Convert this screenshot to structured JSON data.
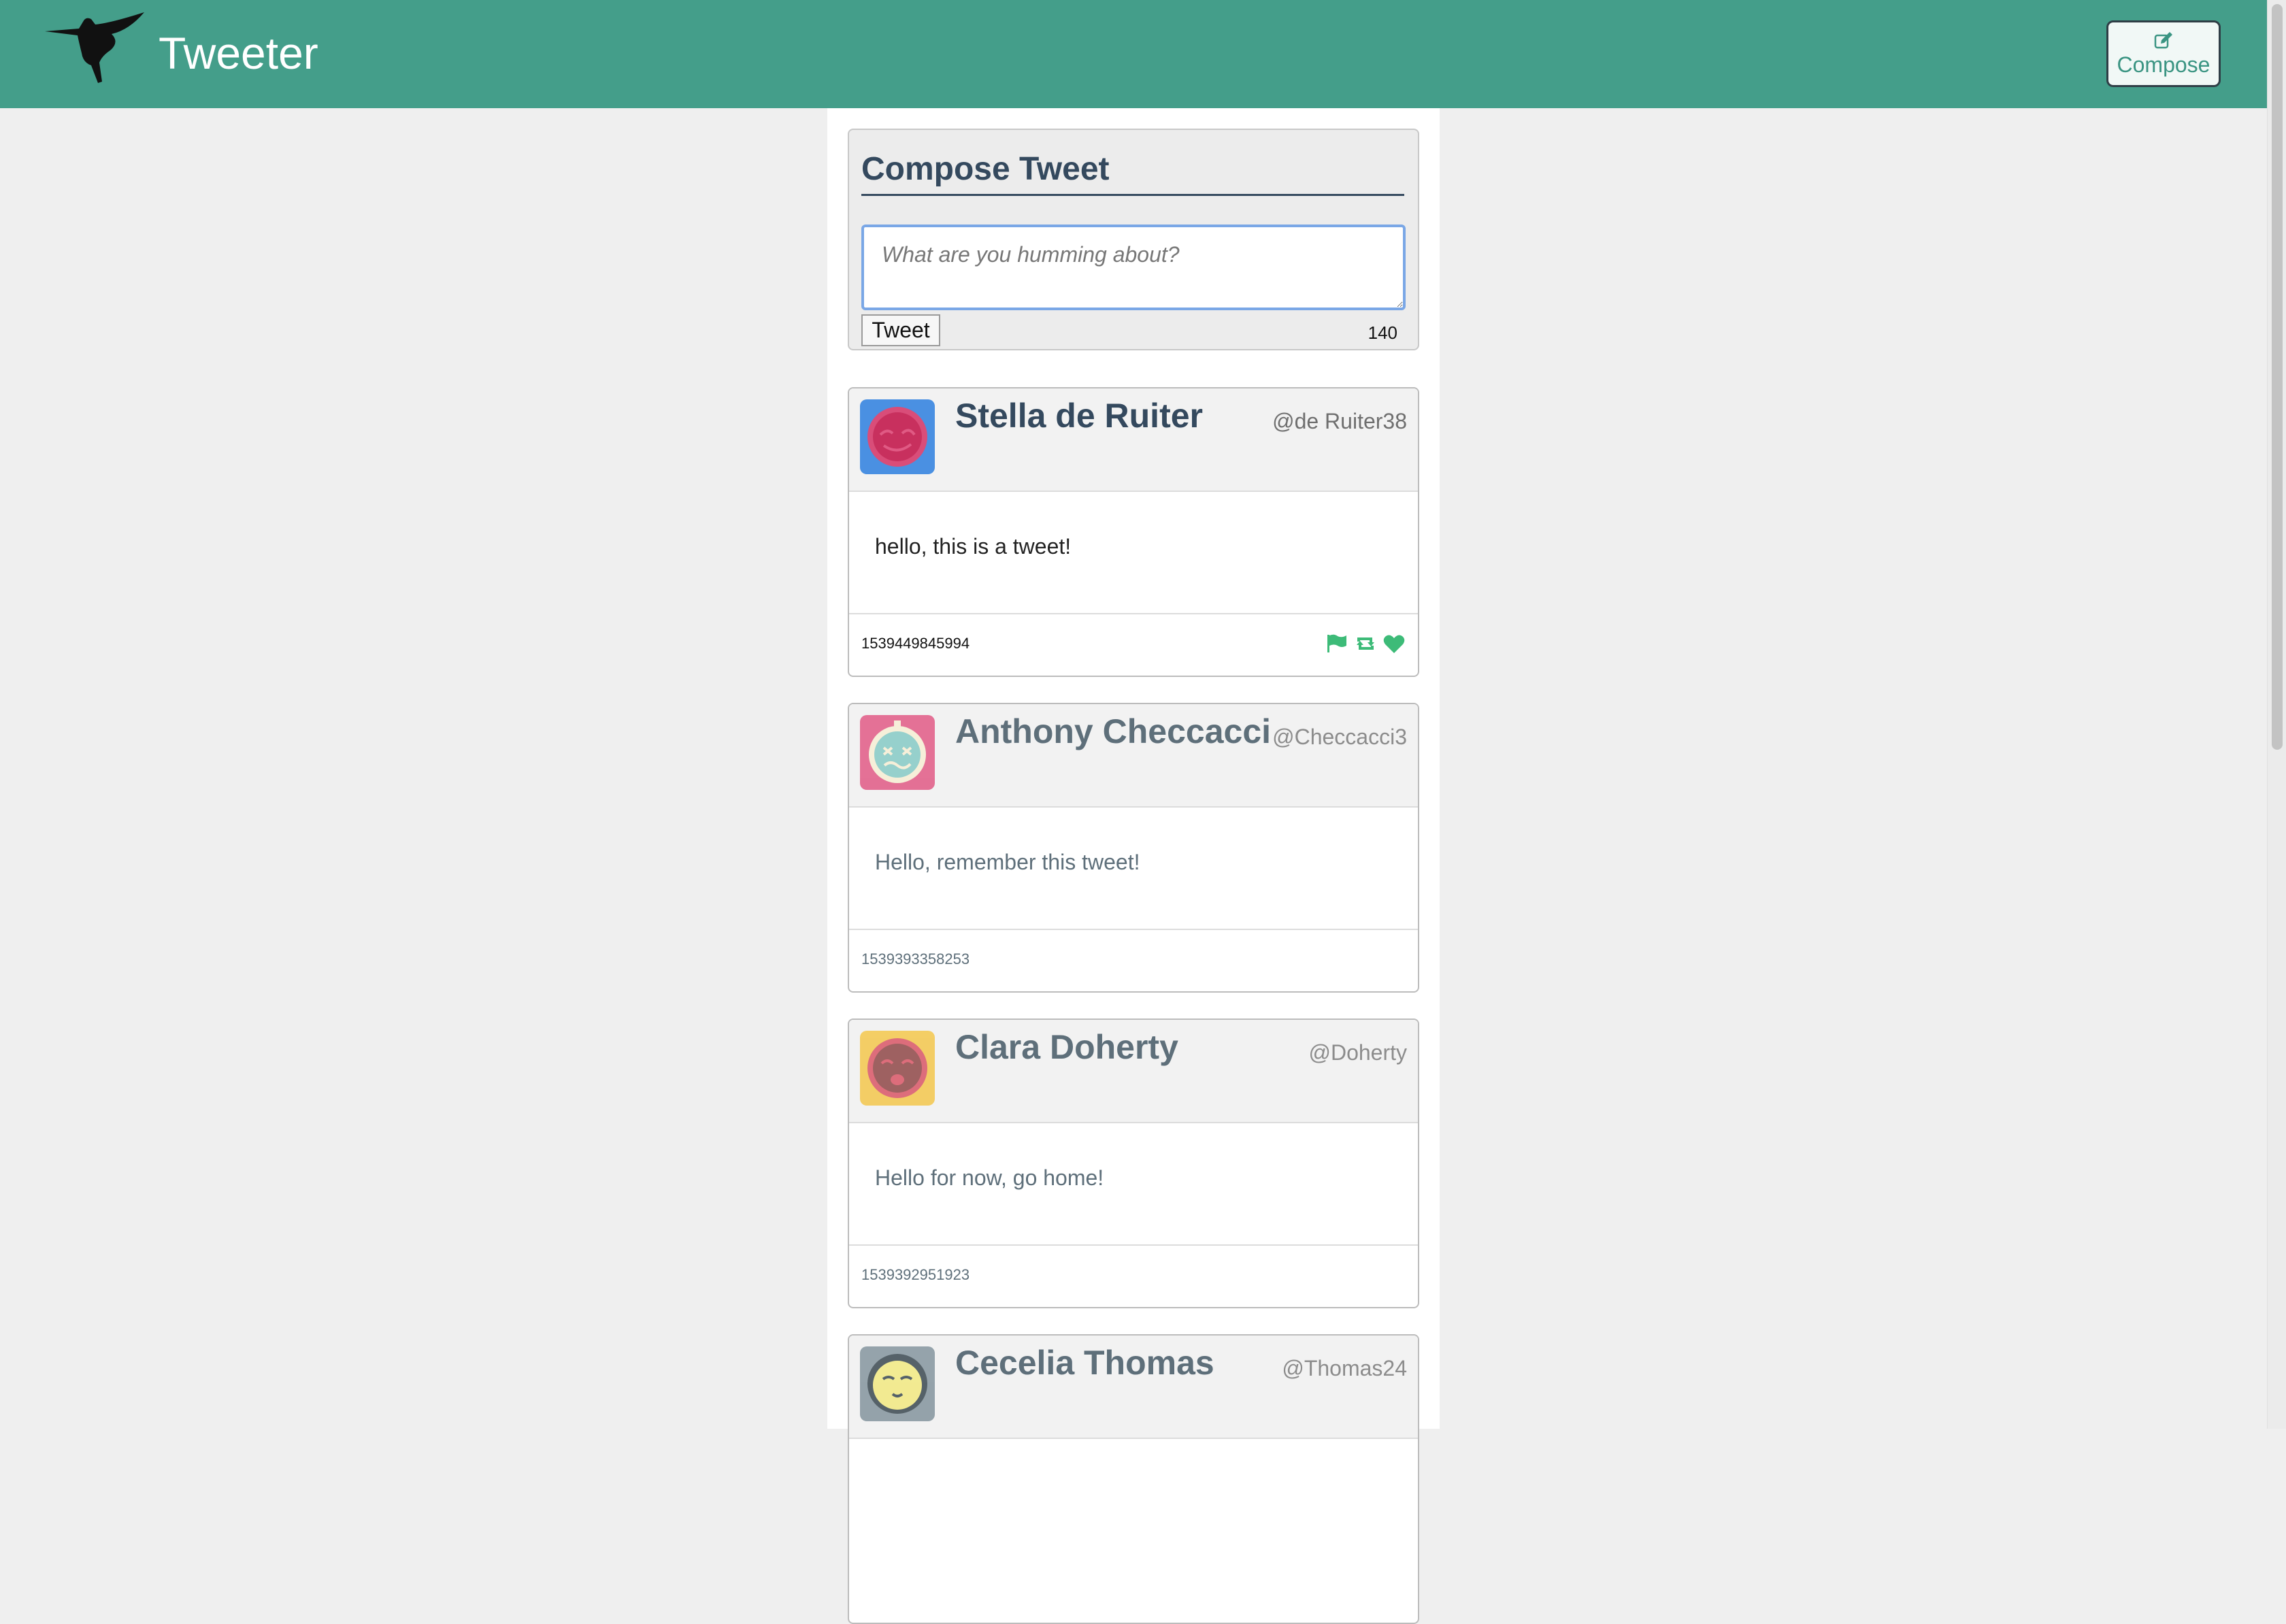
{
  "nav": {
    "brand": "Tweeter",
    "compose_label": "Compose",
    "logo_icon": "hummingbird-icon",
    "compose_icon": "edit-icon"
  },
  "composer": {
    "title": "Compose Tweet",
    "placeholder": "What are you humming about?",
    "tweet_button": "Tweet",
    "char_count": "140"
  },
  "tweets": [
    {
      "name": "Stella de Ruiter",
      "handle": "@de Ruiter38",
      "text": "hello, this is a tweet!",
      "timestamp": "1539449845994",
      "avatar_color": "#4a90e2",
      "actions": [
        "flag-icon",
        "retweet-icon",
        "heart-icon"
      ]
    },
    {
      "name": "Anthony Checcacci",
      "handle": "@Checcacci3",
      "text": "Hello, remember this tweet!",
      "timestamp": "1539393358253",
      "avatar_color": "#e0507f"
    },
    {
      "name": "Clara Doherty",
      "handle": "@Doherty",
      "text": "Hello for now, go home!",
      "timestamp": "1539392951923",
      "avatar_color": "#f4c542"
    },
    {
      "name": "Cecelia Thomas",
      "handle": "@Thomas24",
      "avatar_color": "#7d8f99"
    }
  ],
  "colors": {
    "nav_bg": "#449e8a",
    "accent": "#3dbb78",
    "text_dark": "#34495e"
  }
}
